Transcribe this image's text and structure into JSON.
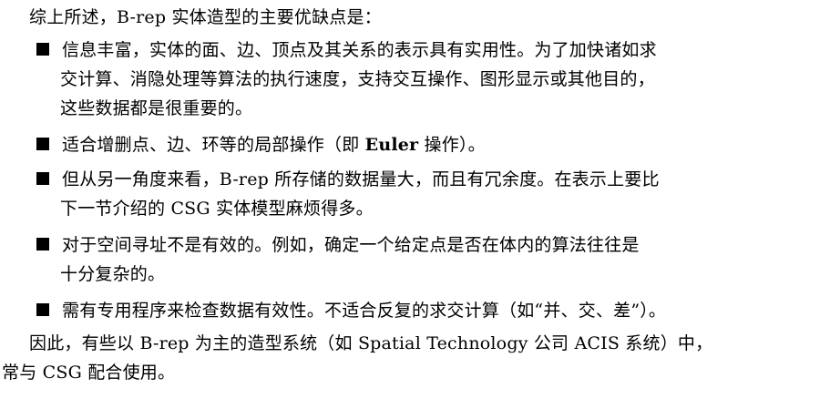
{
  "intro": "综上所述，B-rep 实体造型的主要优缺点是：",
  "bullets": [
    {
      "lines": [
        "信息丰富，实体的面、边、顶点及其关系的表示具有实用性。为了加快诸如求",
        "交计算、消隐处理等算法的执行速度，支持交互操作、图形显示或其他目的，",
        "这些数据都是很重要的。"
      ]
    },
    {
      "before": "适合增删点、边、环等的局部操作（即 ",
      "bold": "Euler",
      "after": " 操作）。"
    },
    {
      "lines": [
        "但从另一角度来看，B-rep 所存储的数据量大，而且有冗余度。在表示上要比",
        "下一节介绍的 CSG 实体模型麻烦得多。"
      ]
    },
    {
      "lines": [
        "对于空间寻址不是有效的。例如，确定一个给定点是否在体内的算法往往是",
        "十分复杂的。"
      ]
    },
    {
      "lines": [
        "需有专用程序来检查数据有效性。不适合反复的求交计算（如“并、交、差”）。"
      ]
    }
  ],
  "conclusion": {
    "line1": "因此，有些以 B-rep 为主的造型系统（如 Spatial Technology 公司 ACIS 系统）中，",
    "line2": "常与 CSG 配合使用。"
  }
}
